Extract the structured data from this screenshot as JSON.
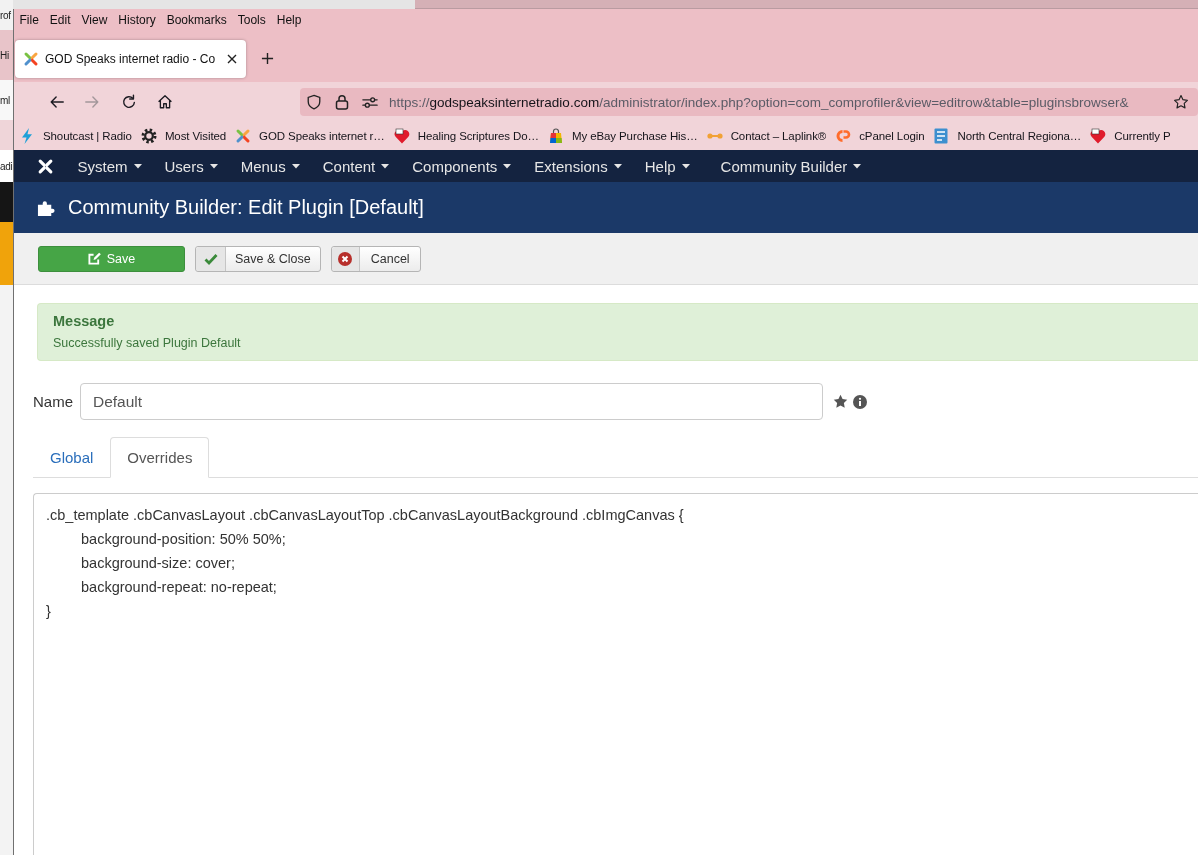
{
  "background_windows": {
    "edge_texts": [
      "rof",
      "Hi",
      "ml",
      "adi"
    ]
  },
  "menu_bar": [
    "File",
    "Edit",
    "View",
    "History",
    "Bookmarks",
    "Tools",
    "Help"
  ],
  "browser_tabs": [
    {
      "title": "GOD Speaks internet radio - Co",
      "selected": true
    }
  ],
  "nav_buttons": [
    {
      "kind": "back",
      "disabled": false
    },
    {
      "kind": "forward",
      "disabled": true
    },
    {
      "kind": "reload",
      "disabled": false
    },
    {
      "kind": "home",
      "disabled": false
    }
  ],
  "address_bar": {
    "scheme": "https://",
    "host": "godspeaksinternetradio.com",
    "path": "/administrator/index.php?option=com_comprofiler&view=editrow&table=pluginsbrowser&"
  },
  "bookmarks": [
    "Shoutcast | Radio",
    "Most Visited",
    "GOD Speaks internet r…",
    "Healing Scriptures Do…",
    "My eBay Purchase His…",
    "Contact – Laplink®",
    "cPanel Login",
    "North Central Regiona…",
    "Currently P"
  ],
  "admin_menu": [
    {
      "items": [
        "System",
        "Users",
        "Menus",
        "Content",
        "Components",
        "Extensions",
        "Help"
      ]
    },
    {
      "items": [
        "Community Builder"
      ]
    }
  ],
  "page_header": {
    "title": "Community Builder: Edit Plugin [Default]"
  },
  "toolbar": [
    {
      "kind": "save",
      "label": "Save"
    },
    {
      "kind": "save_close",
      "label": "Save & Close"
    },
    {
      "kind": "cancel",
      "label": "Cancel"
    }
  ],
  "message": {
    "heading": "Message",
    "text": "Successfully saved Plugin Default"
  },
  "name_field": {
    "label": "Name",
    "value": "Default"
  },
  "form_tabs": [
    {
      "label": "Global",
      "selected": false
    },
    {
      "label": "Overrides",
      "selected": true
    }
  ],
  "css_editor": {
    "value": ".cb_template .cbCanvasLayout .cbCanvasLayoutTop .cbCanvasLayoutBackground .cbImgCanvas {\n\tbackground-position: 50% 50%;\n\tbackground-size: cover;\n\tbackground-repeat: no-repeat;\n}"
  }
}
